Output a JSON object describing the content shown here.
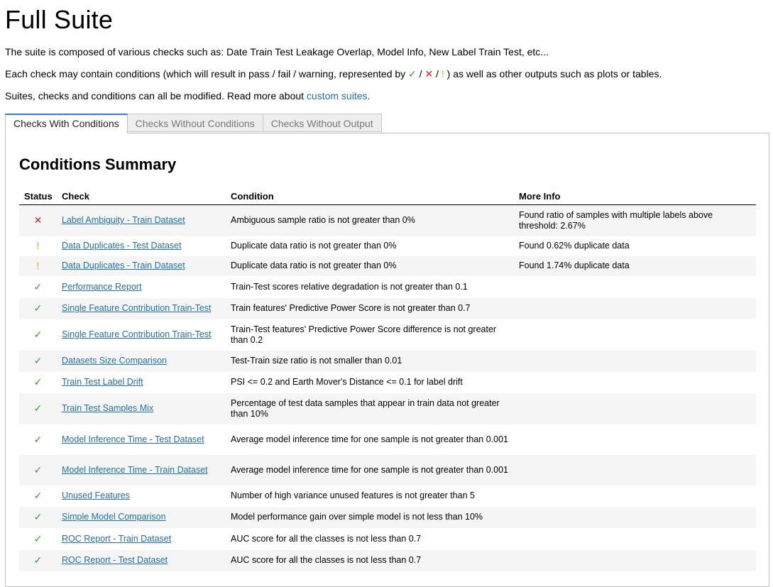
{
  "title": "Full Suite",
  "intro": {
    "line1": "The suite is composed of various checks such as: Date Train Test Leakage Overlap, Model Info, New Label Train Test, etc...",
    "line2_before": "Each check may contain conditions (which will result in pass / fail / warning, represented by ",
    "pass_symbol": "✓",
    "fail_symbol": "✕",
    "warn_symbol": "!",
    "separator": " / ",
    "line2_after": " ) as well as other outputs such as plots or tables.",
    "line3_before": "Suites, checks and conditions can all be modified. Read more about ",
    "line3_link": "custom suites",
    "line3_after": "."
  },
  "tabs": [
    {
      "label": "Checks With Conditions",
      "active": true
    },
    {
      "label": "Checks Without Conditions",
      "active": false
    },
    {
      "label": "Checks Without Output",
      "active": false
    }
  ],
  "summary": {
    "heading": "Conditions Summary",
    "columns": [
      "Status",
      "Check",
      "Condition",
      "More Info"
    ],
    "rows": [
      {
        "status": "fail",
        "check": "Label Ambiguity - Train Dataset",
        "condition": "Ambiguous sample ratio is not greater than 0%",
        "info": "Found ratio of samples with multiple labels above threshold: 2.67%",
        "h": 44
      },
      {
        "status": "warn",
        "check": "Data Duplicates - Test Dataset",
        "condition": "Duplicate data ratio is not greater than 0%",
        "info": "Found 0.62% duplicate data",
        "h": 28
      },
      {
        "status": "warn",
        "check": "Data Duplicates - Train Dataset",
        "condition": "Duplicate data ratio is not greater than 0%",
        "info": "Found 1.74% duplicate data",
        "h": 28
      },
      {
        "status": "pass",
        "check": "Performance Report",
        "condition": "Train-Test scores relative degradation is not greater than 0.1",
        "info": "",
        "h": 31
      },
      {
        "status": "pass",
        "check": "Single Feature Contribution Train-Test",
        "condition": "Train features' Predictive Power Score is not greater than 0.7",
        "info": "",
        "h": 30
      },
      {
        "status": "pass",
        "check": "Single Feature Contribution Train-Test",
        "condition": "Train-Test features' Predictive Power Score difference is not greater than 0.2",
        "info": "",
        "h": 44
      },
      {
        "status": "pass",
        "check": "Datasets Size Comparison",
        "condition": "Test-Train size ratio is not smaller than 0.01",
        "info": "",
        "h": 30
      },
      {
        "status": "pass",
        "check": "Train Test Label Drift",
        "condition": "PSI <= 0.2 and Earth Mover's Distance <= 0.1 for label drift",
        "info": "",
        "h": 30
      },
      {
        "status": "pass",
        "check": "Train Test Samples Mix",
        "condition": "Percentage of test data samples that appear in train data not greater than 10%",
        "info": "",
        "h": 44
      },
      {
        "status": "pass",
        "check": "Model Inference Time - Test Dataset",
        "condition": "Average model inference time for one sample is not greater than 0.001",
        "info": "",
        "h": 43
      },
      {
        "status": "pass",
        "check": "Model Inference Time - Train Dataset",
        "condition": "Average model inference time for one sample is not greater than 0.001",
        "info": "",
        "h": 43
      },
      {
        "status": "pass",
        "check": "Unused Features",
        "condition": "Number of high variance unused features is not greater than 5",
        "info": "",
        "h": 30
      },
      {
        "status": "pass",
        "check": "Simple Model Comparison",
        "condition": "Model performance gain over simple model is not less than 10%",
        "info": "",
        "h": 30
      },
      {
        "status": "pass",
        "check": "ROC Report - Train Dataset",
        "condition": "AUC score for all the classes is not less than 0.7",
        "info": "",
        "h": 31
      },
      {
        "status": "pass",
        "check": "ROC Report - Test Dataset",
        "condition": "AUC score for all the classes is not less than 0.7",
        "info": "",
        "h": 30
      }
    ]
  },
  "colors": {
    "pass": "#2e9e2e",
    "fail": "#e02020",
    "warn": "#f29d0e",
    "link": "#1f6fb0",
    "tab_accent": "#2d7bd2"
  }
}
